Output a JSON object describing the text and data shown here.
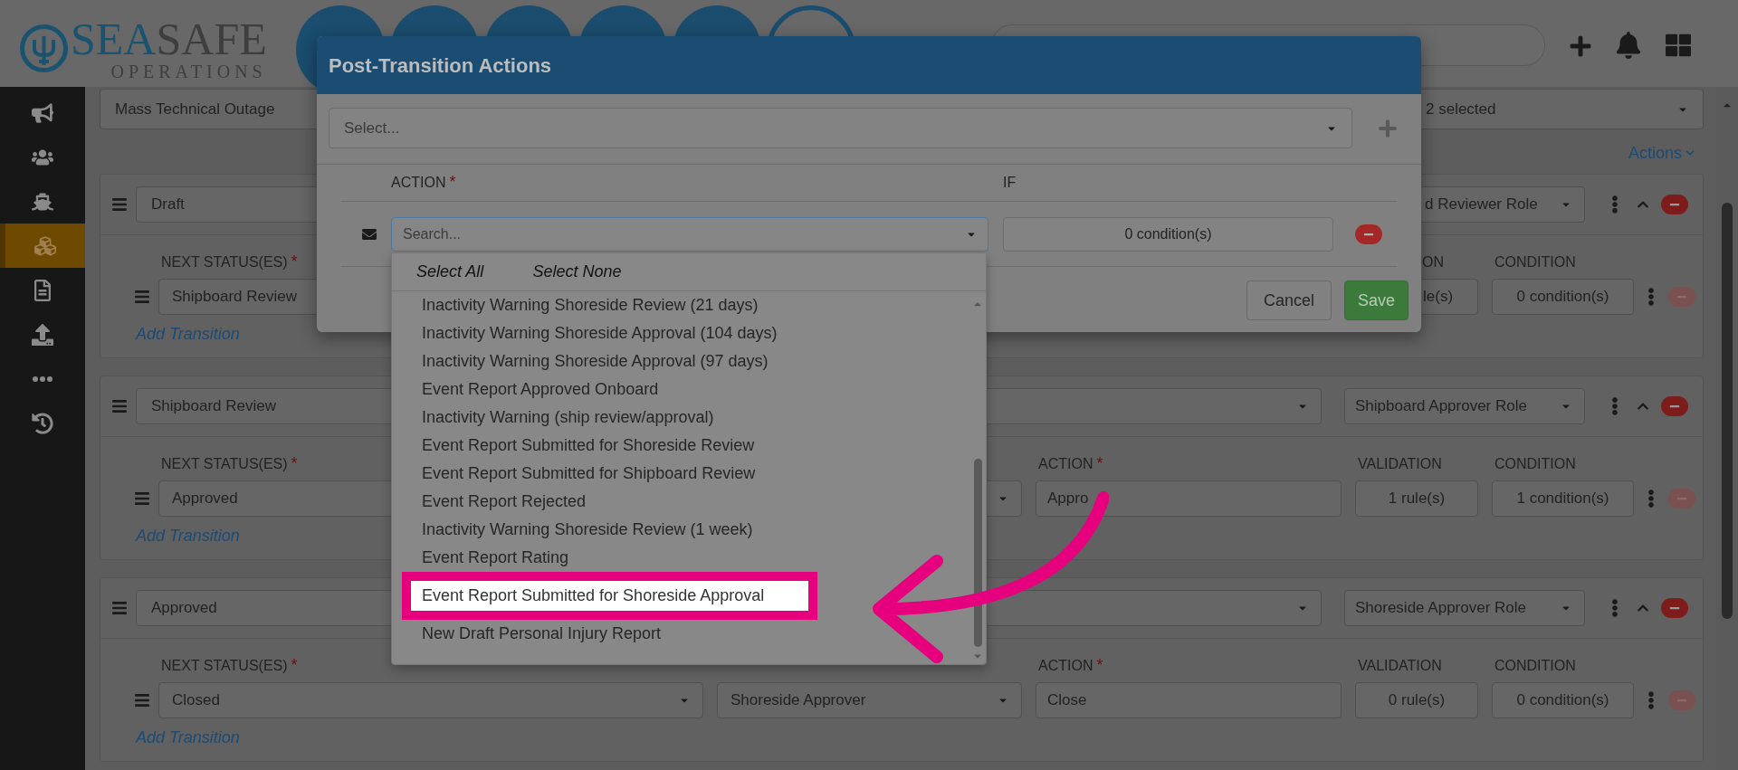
{
  "logo": {
    "word_1": "SEA",
    "word_2": "SAFE",
    "tagline": "OPERATIONS"
  },
  "nav_buttons": [
    {
      "kind": "filled"
    },
    {
      "kind": "filled"
    },
    {
      "kind": "filled"
    },
    {
      "kind": "filled"
    },
    {
      "kind": "filled"
    },
    {
      "kind": "outline"
    }
  ],
  "sidebar": {
    "items": [
      {
        "selected": false
      },
      {
        "selected": false
      },
      {
        "selected": false
      },
      {
        "selected": true
      },
      {
        "selected": false
      },
      {
        "selected": false
      },
      {
        "selected": false
      },
      {
        "selected": false
      }
    ]
  },
  "filters": {
    "template": "Mass Technical Outage",
    "selection": "2 selected"
  },
  "actions_link": "Actions",
  "cards": [
    {
      "status": "Draft",
      "role": "d Reviewer Role",
      "labels": {
        "next_status": {
          "text": "NEXT STATUS(ES)",
          "mark": "*"
        },
        "validation": {
          "text": "ON"
        },
        "condition": {
          "text": "CONDITION"
        }
      },
      "transitions": [
        {
          "next_status": "Shipboard Review",
          "validation": "le(s)",
          "condition": "0 condition(s)",
          "remove_disabled": true
        }
      ],
      "add_link": "Add Transition"
    },
    {
      "status": "Shipboard Review",
      "role": "Shipboard Approver Role",
      "labels": {
        "next_status": {
          "text": "NEXT STATUS(ES)",
          "mark": "*"
        },
        "action": {
          "text": "ACTION",
          "mark": "*"
        },
        "validation": {
          "text": "VALIDATION"
        },
        "condition": {
          "text": "CONDITION"
        }
      },
      "transitions": [
        {
          "next_status": "Approved",
          "action": "Appro",
          "validation": "1 rule(s)",
          "condition": "1 condition(s)",
          "remove_disabled": true
        }
      ],
      "add_link": "Add Transition"
    },
    {
      "status": "Approved",
      "role": "Shoreside Approver Role",
      "labels": {
        "next_status": {
          "text": "NEXT STATUS(ES)",
          "mark": "*"
        },
        "action": {
          "text": "ACTION",
          "mark": "*"
        },
        "validation": {
          "text": "VALIDATION"
        },
        "condition": {
          "text": "CONDITION"
        }
      },
      "transitions": [
        {
          "next_status": "Closed",
          "role": "Shoreside Approver",
          "action": "Close",
          "validation": "0 rule(s)",
          "condition": "0 condition(s)",
          "remove_disabled": true
        }
      ],
      "add_link": "Add Transition"
    }
  ],
  "modal": {
    "title": "Post-Transition Actions",
    "select_placeholder": "Select...",
    "columns": [
      {
        "text": "ACTION",
        "mark": "*"
      },
      {
        "text": "IF"
      }
    ],
    "rows": [
      {
        "search_placeholder": "Search...",
        "condition": "0 condition(s)"
      }
    ],
    "buttons": [
      {
        "label": "Cancel",
        "kind": "secondary"
      },
      {
        "label": "Save",
        "kind": "primary"
      }
    ]
  },
  "dropdown": {
    "select_all": "Select All",
    "select_none": "Select None",
    "options": [
      {
        "label": "Inactivity Warning Shoreside Review (21 days)",
        "highlighted": false
      },
      {
        "label": "Inactivity Warning Shoreside Approval (104 days)",
        "highlighted": false
      },
      {
        "label": "Inactivity Warning Shoreside Approval (97 days)",
        "highlighted": false
      },
      {
        "label": "Event Report Approved Onboard",
        "highlighted": false
      },
      {
        "label": "Inactivity Warning (ship review/approval)",
        "highlighted": false
      },
      {
        "label": "Event Report Submitted for Shoreside Review",
        "highlighted": false
      },
      {
        "label": "Event Report Submitted for Shipboard Review",
        "highlighted": false
      },
      {
        "label": "Event Report Rejected",
        "highlighted": false
      },
      {
        "label": "Inactivity Warning Shoreside Review (1 week)",
        "highlighted": false
      },
      {
        "label": "Event Report Rating",
        "highlighted": false
      },
      {
        "label": "Event Report Submitted for Shoreside Approval",
        "highlighted": true
      },
      {
        "label": "New Draft Personal Injury Report",
        "highlighted": false
      }
    ]
  }
}
